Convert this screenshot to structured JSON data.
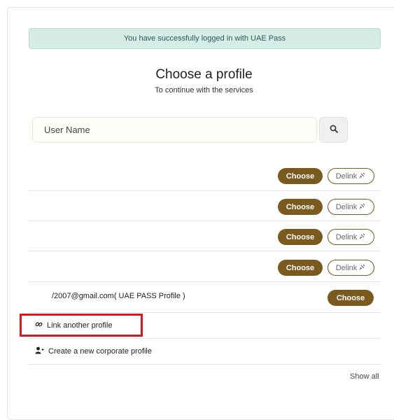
{
  "alert": {
    "message": "You have successfully logged in with UAE Pass"
  },
  "header": {
    "title": "Choose a profile",
    "subtitle": "To continue with the services"
  },
  "search": {
    "placeholder": "User Name"
  },
  "profiles": [
    {
      "choose_label": "Choose",
      "delink_label": "Delink"
    },
    {
      "choose_label": "Choose",
      "delink_label": "Delink"
    },
    {
      "choose_label": "Choose",
      "delink_label": "Delink"
    },
    {
      "choose_label": "Choose",
      "delink_label": "Delink"
    }
  ],
  "uae_pass_profile": {
    "email": "/2007@gmail.com( UAE PASS Profile )",
    "choose_label": "Choose"
  },
  "actions": {
    "link_profile": "Link another profile",
    "create_corporate": "Create a new corporate profile"
  },
  "footer": {
    "show_all": "Show all"
  },
  "colors": {
    "brand": "#7a5a1f",
    "alert_bg": "#d6ece6",
    "highlight": "#e3141d"
  },
  "icons": {
    "search": "search-icon",
    "delink": "unlink-icon",
    "link": "link-icon",
    "add_user": "user-plus-icon"
  }
}
